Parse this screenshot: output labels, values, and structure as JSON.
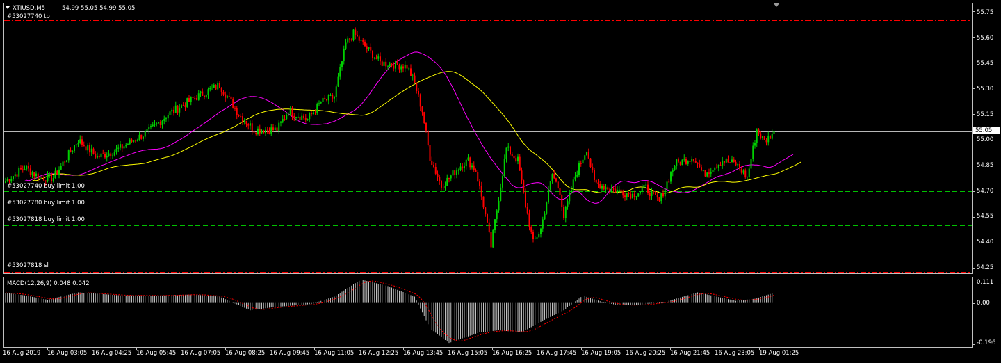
{
  "window": {
    "symbol_label": "XTIUSD,M5",
    "ohlc_label": "54.99 55.05 54.99 55.05",
    "current_price": "55.05"
  },
  "orders": {
    "tp_label": "#53027740 tp",
    "sl_label": "#53027818 sl",
    "buy_limits": [
      "#53027740 buy limit 1.00",
      "#53027780 buy limit 1.00",
      "#53027818 buy limit 1.00"
    ]
  },
  "price_axis": [
    "55.75",
    "55.60",
    "55.45",
    "55.30",
    "55.15",
    "55.00",
    "54.85",
    "54.70",
    "54.55",
    "54.40",
    "54.25"
  ],
  "indicator": {
    "label": "MACD(12,26,9) 0.048 0.042",
    "axis": [
      "0.111",
      "0.00",
      "-0.196"
    ]
  },
  "time_axis": [
    "16 Aug 2019",
    "16 Aug 03:05",
    "16 Aug 04:25",
    "16 Aug 05:45",
    "16 Aug 07:05",
    "16 Aug 08:25",
    "16 Aug 09:45",
    "16 Aug 11:05",
    "16 Aug 12:25",
    "16 Aug 13:45",
    "16 Aug 15:05",
    "16 Aug 16:25",
    "16 Aug 17:45",
    "16 Aug 19:05",
    "16 Aug 20:25",
    "16 Aug 21:45",
    "16 Aug 23:05",
    "19 Aug 01:25"
  ],
  "colors": {
    "background": "#000000",
    "bull_candle": "#00d000",
    "bear_candle": "#ff0000",
    "ma_fast": "#ff00ff",
    "ma_slow": "#ffff00",
    "tp_sl_line": "#ff0000",
    "buy_limit_line": "#00c000",
    "macd_histogram": "#c0c0c0",
    "macd_signal": "#ff0000",
    "grid_frame": "#c0c0c0"
  },
  "chart_data": {
    "type": "candlestick",
    "timeframe": "M5",
    "ylim": [
      54.23,
      55.8
    ],
    "macd_ylim": [
      -0.196,
      0.111
    ],
    "levels": {
      "take_profit": 55.7,
      "buy_limit_1": 54.7,
      "buy_limit_2": 54.6,
      "buy_limit_3": 54.5,
      "stop_loss": 54.23,
      "current": 55.05
    },
    "anchors": [
      [
        0,
        54.76
      ],
      [
        10,
        54.84
      ],
      [
        18,
        54.78
      ],
      [
        25,
        54.78
      ],
      [
        38,
        55.0
      ],
      [
        48,
        54.9
      ],
      [
        58,
        54.94
      ],
      [
        75,
        55.05
      ],
      [
        85,
        55.15
      ],
      [
        98,
        55.24
      ],
      [
        112,
        55.32
      ],
      [
        118,
        55.22
      ],
      [
        122,
        55.15
      ],
      [
        130,
        55.06
      ],
      [
        142,
        55.06
      ],
      [
        148,
        55.17
      ],
      [
        158,
        55.12
      ],
      [
        165,
        55.22
      ],
      [
        172,
        55.25
      ],
      [
        178,
        55.56
      ],
      [
        182,
        55.62
      ],
      [
        196,
        55.45
      ],
      [
        210,
        55.43
      ],
      [
        214,
        55.33
      ],
      [
        218,
        55.17
      ],
      [
        222,
        54.9
      ],
      [
        228,
        54.73
      ],
      [
        238,
        54.85
      ],
      [
        242,
        54.88
      ],
      [
        246,
        54.82
      ],
      [
        250,
        54.62
      ],
      [
        254,
        54.38
      ],
      [
        262,
        54.95
      ],
      [
        268,
        54.88
      ],
      [
        272,
        54.62
      ],
      [
        276,
        54.4
      ],
      [
        280,
        54.48
      ],
      [
        286,
        54.8
      ],
      [
        290,
        54.7
      ],
      [
        292,
        54.55
      ],
      [
        298,
        54.79
      ],
      [
        304,
        54.95
      ],
      [
        308,
        54.75
      ],
      [
        315,
        54.72
      ],
      [
        328,
        54.68
      ],
      [
        335,
        54.72
      ],
      [
        342,
        54.64
      ],
      [
        350,
        54.86
      ],
      [
        360,
        54.9
      ],
      [
        365,
        54.8
      ],
      [
        375,
        54.88
      ],
      [
        382,
        54.86
      ],
      [
        388,
        54.78
      ],
      [
        393,
        55.06
      ],
      [
        397,
        54.99
      ],
      [
        402,
        55.05
      ]
    ],
    "macd": {
      "histogram_anchors": [
        [
          0,
          0.048
        ],
        [
          10,
          0.036
        ],
        [
          22,
          0.015
        ],
        [
          38,
          0.05
        ],
        [
          60,
          0.036
        ],
        [
          80,
          0.035
        ],
        [
          98,
          0.04
        ],
        [
          112,
          0.03
        ],
        [
          128,
          -0.035
        ],
        [
          140,
          -0.02
        ],
        [
          160,
          -0.005
        ],
        [
          172,
          0.03
        ],
        [
          186,
          0.111
        ],
        [
          200,
          0.08
        ],
        [
          214,
          0.03
        ],
        [
          222,
          -0.12
        ],
        [
          232,
          -0.19
        ],
        [
          248,
          -0.14
        ],
        [
          258,
          -0.13
        ],
        [
          270,
          -0.14
        ],
        [
          282,
          -0.08
        ],
        [
          292,
          -0.035
        ],
        [
          302,
          0.035
        ],
        [
          312,
          0.005
        ],
        [
          320,
          -0.01
        ],
        [
          330,
          -0.01
        ],
        [
          345,
          0.005
        ],
        [
          362,
          0.05
        ],
        [
          372,
          0.03
        ],
        [
          382,
          0.01
        ],
        [
          392,
          0.02
        ],
        [
          402,
          0.048
        ]
      ],
      "last_histogram": 0.048,
      "last_signal": 0.042
    }
  }
}
